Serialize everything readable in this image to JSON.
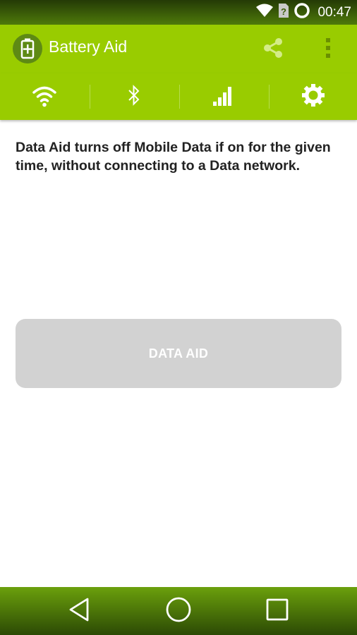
{
  "status_bar": {
    "time": "00:47",
    "icons": [
      "wifi-signal-icon",
      "sim-unknown-icon",
      "battery-ring-icon"
    ],
    "unknown_sim_glyph": "?"
  },
  "app_bar": {
    "title": "Battery Aid",
    "logo_icon": "battery-plus-icon",
    "actions": [
      "share-icon",
      "overflow-menu-icon"
    ]
  },
  "tabs": [
    {
      "icon": "wifi-icon"
    },
    {
      "icon": "bluetooth-icon"
    },
    {
      "icon": "mobile-signal-icon"
    },
    {
      "icon": "settings-gear-icon"
    }
  ],
  "main": {
    "description": "Data Aid turns off Mobile Data if on for the given time, without connecting to a Data network.",
    "button_label": "DATA AID"
  },
  "nav_bar": {
    "buttons": [
      "back-icon",
      "home-icon",
      "recents-icon"
    ]
  },
  "colors": {
    "accent": "#99cc00",
    "status_bar": "#3a5c08",
    "nav_bar": "#4e7a0a",
    "button_disabled": "#d2d2d2"
  }
}
